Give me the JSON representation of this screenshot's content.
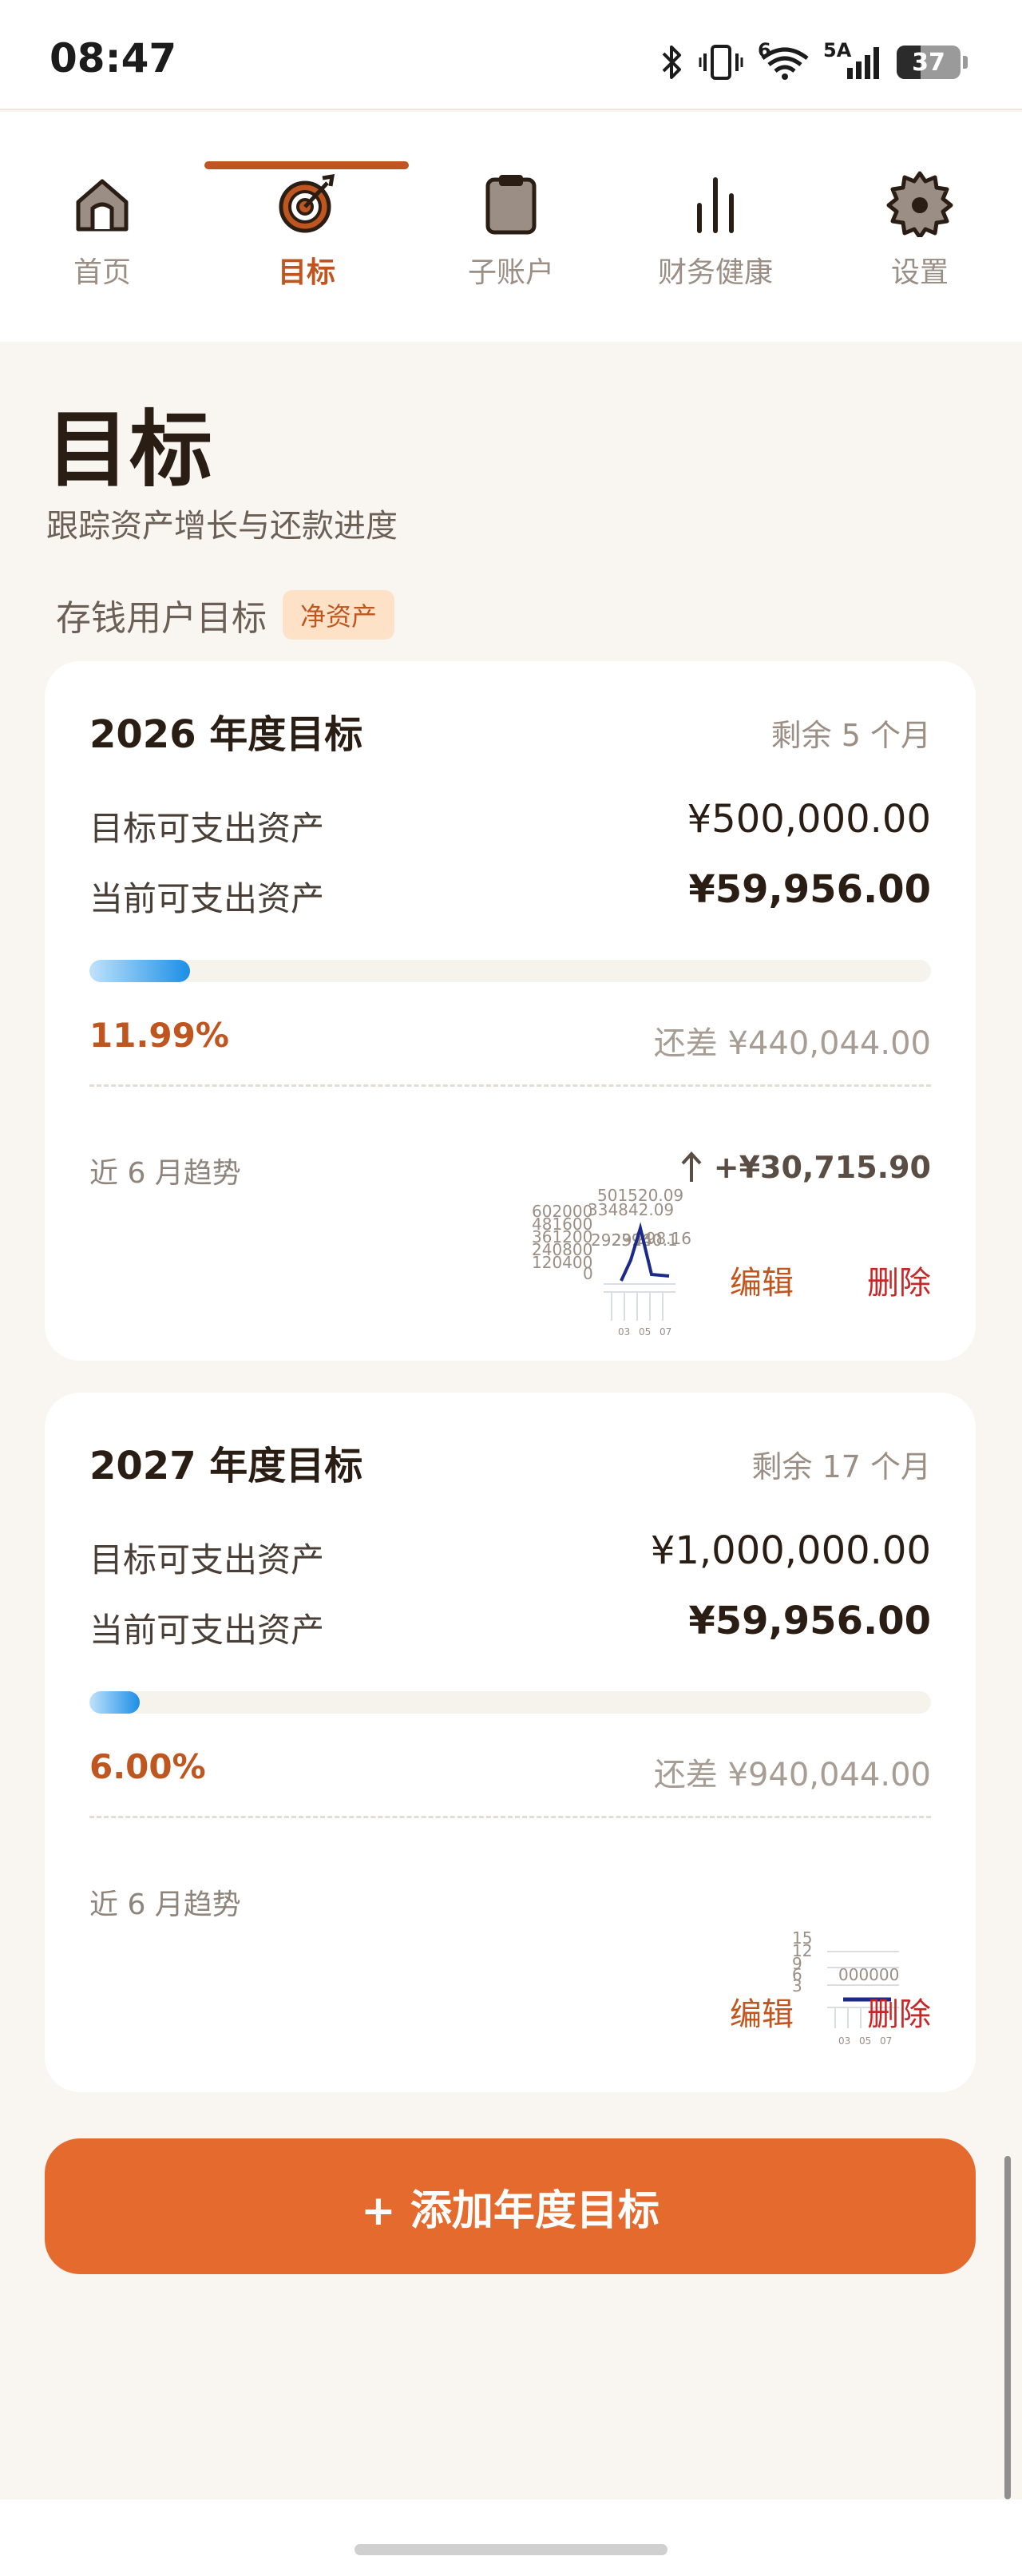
{
  "status_bar": {
    "time": "08:47",
    "network_label": "5A",
    "wifi_label": "6",
    "battery": "37",
    "icons": [
      "bluetooth-icon",
      "vibrate-icon",
      "wifi-icon",
      "signal-icon",
      "battery-icon"
    ]
  },
  "nav": {
    "tabs": [
      {
        "label": "首页",
        "icon": "home-icon"
      },
      {
        "label": "目标",
        "icon": "target-icon",
        "active": true
      },
      {
        "label": "子账户",
        "icon": "clipboard-icon"
      },
      {
        "label": "财务健康",
        "icon": "bar-chart-icon"
      },
      {
        "label": "设置",
        "icon": "gear-icon"
      }
    ]
  },
  "header": {
    "title": "目标",
    "subtitle": "跟踪资产增长与还款进度"
  },
  "section": {
    "label": "存钱用户目标",
    "badge": "净资产"
  },
  "goals": [
    {
      "title": "2026 年度目标",
      "remaining": "剩余 5 个月",
      "target_label": "目标可支出资产",
      "target_value": "¥500,000.00",
      "current_label": "当前可支出资产",
      "current_value": "¥59,956.00",
      "progress": 0.1199,
      "percent_text": "11.99%",
      "gap_text": "还差 ¥440,044.00",
      "trend_label": "近 6 月趋势",
      "trend_delta": "+¥30,715.90",
      "edit_label": "编辑",
      "delete_label": "删除",
      "sparkline": {
        "labels": [
          "501520.09",
          "602000",
          "334842.09",
          "481600",
          "361200",
          "240800",
          "120400",
          "0",
          "292396",
          "29240.1",
          "298.16"
        ],
        "x_ticks": [
          "03",
          "05",
          "07"
        ]
      }
    },
    {
      "title": "2027 年度目标",
      "remaining": "剩余 17 个月",
      "target_label": "目标可支出资产",
      "target_value": "¥1,000,000.00",
      "current_label": "当前可支出资产",
      "current_value": "¥59,956.00",
      "progress": 0.06,
      "percent_text": "6.00%",
      "gap_text": "还差 ¥940,044.00",
      "trend_label": "近 6 月趋势",
      "edit_label": "编辑",
      "delete_label": "删除",
      "sparkline": {
        "labels": [
          "15",
          "12",
          "9",
          "6",
          "3",
          "000000"
        ],
        "x_ticks": [
          "03",
          "05",
          "07"
        ]
      }
    }
  ],
  "add_button": "+ 添加年度目标",
  "colors": {
    "accent": "#c0561f",
    "button": "#e56a2d",
    "danger": "#c62828",
    "progress_start": "#bfe2fb",
    "progress_end": "#1b8fe6",
    "background": "#f9f6f1"
  }
}
